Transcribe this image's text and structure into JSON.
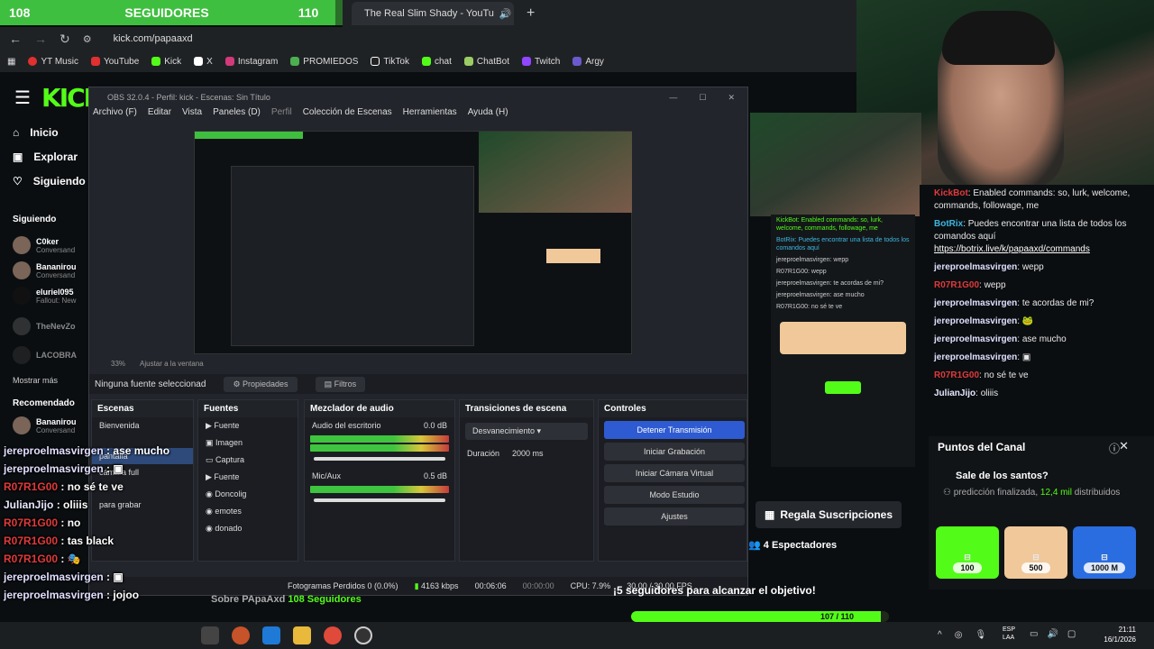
{
  "follower_bar": {
    "current": "108",
    "label": "SEGUIDORES",
    "goal": "110",
    "fraction": 0.98
  },
  "browser": {
    "tab_title": "The Real Slim Shady - YouTu",
    "url": "kick.com/papaaxd",
    "bookmarks": [
      "YT Music",
      "YouTube",
      "Kick",
      "X",
      "Instagram",
      "PROMIEDOS",
      "TikTok",
      "chat",
      "ChatBot",
      "Twitch",
      "Argy"
    ]
  },
  "kick": {
    "nav": [
      "Inicio",
      "Explorar",
      "Siguiendo"
    ],
    "following_title": "Siguiendo",
    "following": [
      {
        "name": "C0ker",
        "sub": "Conversand"
      },
      {
        "name": "Bananirou",
        "sub": "Conversand"
      },
      {
        "name": "eluriel095",
        "sub": "Fallout: New"
      },
      {
        "name": "TheNevZo",
        "sub": ""
      },
      {
        "name": "LACOBRA",
        "sub": ""
      }
    ],
    "show_more": "Mostrar más",
    "recommended_title": "Recomendado",
    "recommended": [
      {
        "name": "Bananirou",
        "sub": "Conversand"
      }
    ],
    "channel_name": "Sobre PApaAxd",
    "channel_followers": "108 Seguidores",
    "viewers": "4 Espectadores",
    "gift_button": "Regala Suscripciones",
    "goal_text": "¡5 seguidores para alcanzar el objetivo!",
    "goal_progress": "107 / 110",
    "goal_fraction": 0.97
  },
  "obs": {
    "title": "OBS 32.0.4 - Perfil: kick - Escenas: Sin Título",
    "menu": [
      "Archivo (F)",
      "Editar",
      "Vista",
      "Paneles (D)",
      "Perfil",
      "Colección de Escenas",
      "Herramientas",
      "Ayuda (H)"
    ],
    "zoom": "33%",
    "fit": "Ajustar a la ventana",
    "no_source": "Ninguna fuente seleccionad",
    "props": "Propiedades",
    "filters": "Filtros",
    "scenes_title": "Escenas",
    "scenes": [
      "Bienvenida",
      "pantalla",
      "cámara full",
      "para grabar"
    ],
    "sources_title": "Fuentes",
    "sources": [
      "Fuente",
      "Imagen",
      "Captura",
      "Fuente",
      "Doncolig",
      "emotes",
      "donado"
    ],
    "mixer_title": "Mezclador de audio",
    "mixer": [
      {
        "name": "Audio del escritorio",
        "db": "0.0 dB"
      },
      {
        "name": "Mic/Aux",
        "db": "0.5 dB"
      }
    ],
    "transitions_title": "Transiciones de escena",
    "transition": "Desvanecimiento",
    "duration_label": "Duración",
    "duration": "2000 ms",
    "controls_title": "Controles",
    "controls": [
      "Detener Transmisión",
      "Iniciar Grabación",
      "Iniciar Cámara Virtual",
      "Modo Estudio",
      "Ajustes"
    ],
    "status": {
      "dropped": "Fotogramas Perdidos 0 (0.0%)",
      "bitrate": "4163 kbps",
      "live": "00:06:06",
      "rec": "00:00:00",
      "cpu": "CPU: 7.9%",
      "fps": "30.00 / 30.00 FPS"
    }
  },
  "chat": [
    {
      "user": "KickBot",
      "text": "Enabled commands: so, lurk, welcome, commands, followage, me"
    },
    {
      "user": "BotRix",
      "text": "Puedes encontrar una lista de todos los comandos aquí",
      "link": "https://botrix.live/k/papaaxd/commands"
    },
    {
      "user": "jereproelmasvirgen",
      "text": "wepp"
    },
    {
      "user": "R07R1G00",
      "text": "wepp"
    },
    {
      "user": "jereproelmasvirgen",
      "text": "te acordas de mi?"
    },
    {
      "user": "jereproelmasvirgen",
      "text": ""
    },
    {
      "user": "jereproelmasvirgen",
      "text": "ase mucho"
    },
    {
      "user": "jereproelmasvirgen",
      "text": ""
    },
    {
      "user": "R07R1G00",
      "text": "no sé te ve"
    },
    {
      "user": "JulianJijo",
      "text": "oliiis"
    }
  ],
  "points": {
    "title": "Puntos del Canal",
    "question": "Sale de los santos?",
    "status": "predicción finalizada,",
    "amount": "12,4 mil",
    "suffix": "distribuidos",
    "options": [
      {
        "value": "100",
        "color": "#53fc18"
      },
      {
        "value": "500",
        "color": "#f0c89a"
      },
      {
        "value": "1000 M",
        "color": "#2a6de0"
      }
    ]
  },
  "overlay_chat": [
    {
      "user": "jereproelmasvirgen",
      "text": "ase mucho"
    },
    {
      "user": "jereproelmasvirgen",
      "text": ""
    },
    {
      "user": "R07R1G00",
      "text": "no sé te ve"
    },
    {
      "user": "JulianJijo",
      "text": "oliiis"
    },
    {
      "user": "R07R1G00",
      "text": "no"
    },
    {
      "user": "R07R1G00",
      "text": "tas black"
    },
    {
      "user": "R07R1G00",
      "text": ""
    },
    {
      "user": "jereproelmasvirgen",
      "text": ""
    },
    {
      "user": "jereproelmasvirgen",
      "text": "jojoo"
    }
  ],
  "taskbar": {
    "lang": "ESP",
    "region": "LAA",
    "time": "21:11",
    "date": "16/1/2026"
  }
}
